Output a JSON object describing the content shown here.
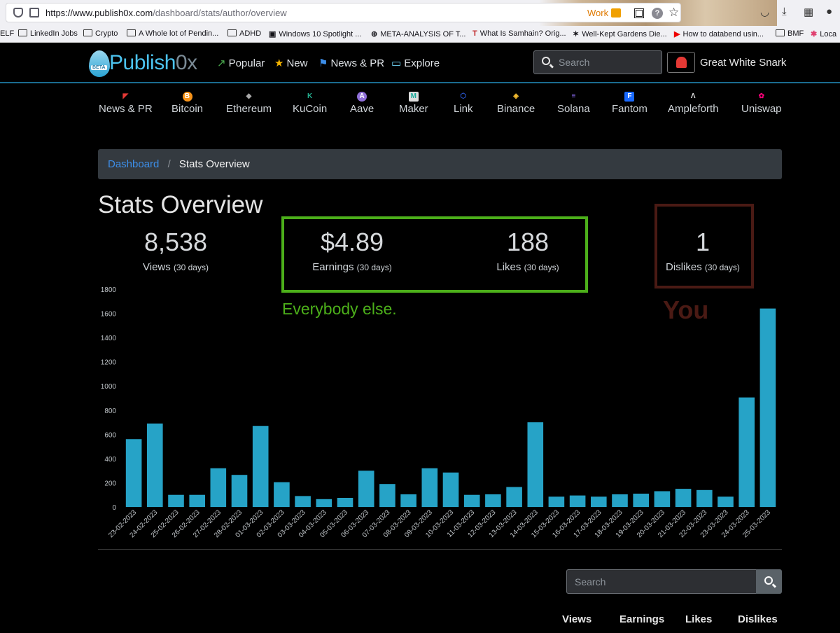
{
  "browser": {
    "url_host": "https://www.publish0x.com",
    "url_path": "/dashboard/stats/author/overview",
    "container_label": "Work"
  },
  "bookmarks": [
    "ELF",
    "LinkedIn Jobs",
    "Crypto",
    "A Whole lot of Pendin...",
    "ADHD",
    "Windows 10 Spotlight ...",
    "META-ANALYSIS OF T...",
    "What Is Samhain? Orig...",
    "Well-Kept Gardens Die...",
    "How to databend usin...",
    "BMF",
    "Loca"
  ],
  "site": {
    "logo_main": "Publish",
    "logo_suffix": "0x",
    "logo_badge": "BETA",
    "nav": [
      "Popular",
      "New",
      "News & PR",
      "Explore"
    ],
    "search_placeholder": "Search",
    "username": "Great White Snark"
  },
  "categories": [
    "News & PR",
    "Bitcoin",
    "Ethereum",
    "KuCoin",
    "Aave",
    "Maker",
    "Link",
    "Binance",
    "Solana",
    "Fantom",
    "Ampleforth",
    "Uniswap"
  ],
  "breadcrumb": {
    "link": "Dashboard",
    "sep": "/",
    "current": "Stats Overview"
  },
  "page_title": "Stats Overview",
  "stats": {
    "views": {
      "value": "8,538",
      "label": "Views",
      "period": "(30 days)"
    },
    "earnings": {
      "value": "$4.89",
      "label": "Earnings",
      "period": "(30 days)"
    },
    "likes": {
      "value": "188",
      "label": "Likes",
      "period": "(30 days)"
    },
    "dislikes": {
      "value": "1",
      "label": "Dislikes",
      "period": "(30 days)"
    }
  },
  "annotations": {
    "green": "Everybody else.",
    "red": "You"
  },
  "colors": {
    "bar": "#26a3c7",
    "green_annotation": "#4caf1a",
    "red_annotation": "#4a1a14",
    "link": "#3d8ee8"
  },
  "chart_data": {
    "type": "bar",
    "categories": [
      "23-02-2023",
      "24-02-2023",
      "25-02-2023",
      "26-02-2023",
      "27-02-2023",
      "28-02-2023",
      "01-03-2023",
      "02-03-2023",
      "03-03-2023",
      "04-03-2023",
      "05-03-2023",
      "06-03-2023",
      "07-03-2023",
      "08-03-2023",
      "09-03-2023",
      "10-03-2023",
      "11-03-2023",
      "12-03-2023",
      "13-03-2023",
      "14-03-2023",
      "15-03-2023",
      "16-03-2023",
      "17-03-2023",
      "18-03-2023",
      "19-03-2023",
      "20-03-2023",
      "21-03-2023",
      "22-03-2023",
      "23-03-2023",
      "24-03-2023",
      "25-03-2023"
    ],
    "values": [
      560,
      690,
      100,
      100,
      320,
      265,
      670,
      205,
      90,
      65,
      75,
      300,
      190,
      105,
      320,
      285,
      100,
      105,
      165,
      700,
      85,
      95,
      85,
      105,
      110,
      130,
      150,
      140,
      85,
      905,
      1640
    ],
    "ylim": [
      0,
      1800
    ],
    "yticks": [
      0,
      200,
      400,
      600,
      800,
      1000,
      1200,
      1400,
      1600,
      1800
    ],
    "grid": false
  },
  "table": {
    "search_placeholder": "Search",
    "columns": [
      "Views",
      "Earnings",
      "Likes",
      "Dislikes"
    ]
  }
}
